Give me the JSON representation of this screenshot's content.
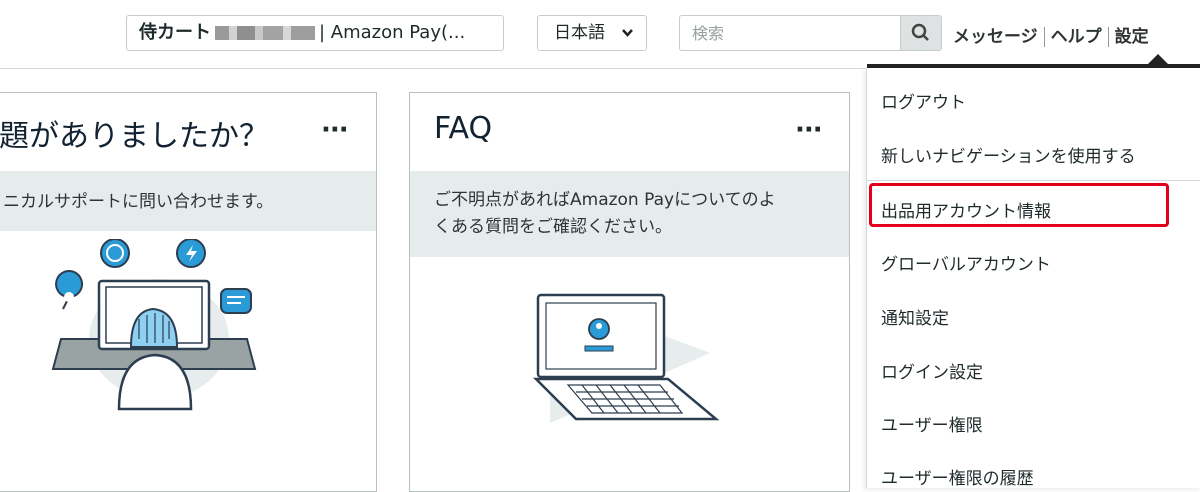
{
  "topbar": {
    "account_prefix": "侍カート",
    "account_suffix": "| Amazon Pay(...",
    "language": "日本語",
    "search_placeholder": "検索",
    "links": [
      "メッセージ",
      "ヘルプ",
      "設定"
    ]
  },
  "cards": [
    {
      "title": "題がありましたか？",
      "more": "···",
      "band_text": "ニカルサポートに問い合わせます。"
    },
    {
      "title": "FAQ",
      "more": "···",
      "band_text_line1": "ご不明点があればAmazon Payについてのよ",
      "band_text_line2": "くある質問をご確認ください。"
    }
  ],
  "settings_menu": {
    "items": [
      "ログアウト",
      "新しいナビゲーションを使用する",
      "出品用アカウント情報",
      "グローバルアカウント",
      "通知設定",
      "ログイン設定",
      "ユーザー権限",
      "ユーザー権限の履歴"
    ],
    "highlighted_item": "出品用アカウント情報",
    "highlight_color": "#e2001a"
  }
}
